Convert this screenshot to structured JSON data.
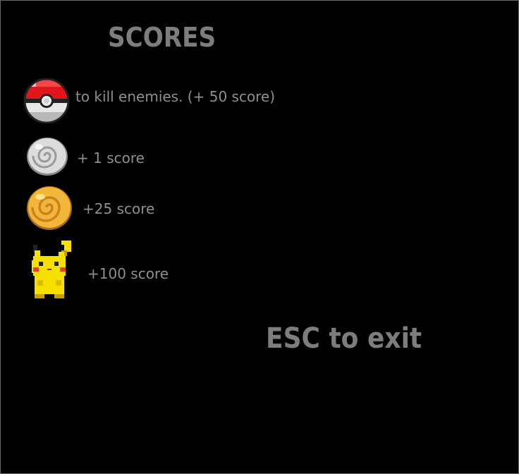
{
  "screen": {
    "title": "SCORES",
    "exit_hint": "ESC to exit"
  },
  "legend": [
    {
      "icon": "pokeball-icon",
      "text": "to kill enemies. (+ 50 score)"
    },
    {
      "icon": "silver-coin-icon",
      "text": "+ 1 score"
    },
    {
      "icon": "gold-coin-icon",
      "text": "+25 score"
    },
    {
      "icon": "pikachu-icon",
      "text": "+100 score"
    }
  ],
  "colors": {
    "background": "#000000",
    "text": "#8f8f8f",
    "heading": "#7d7d7d"
  }
}
